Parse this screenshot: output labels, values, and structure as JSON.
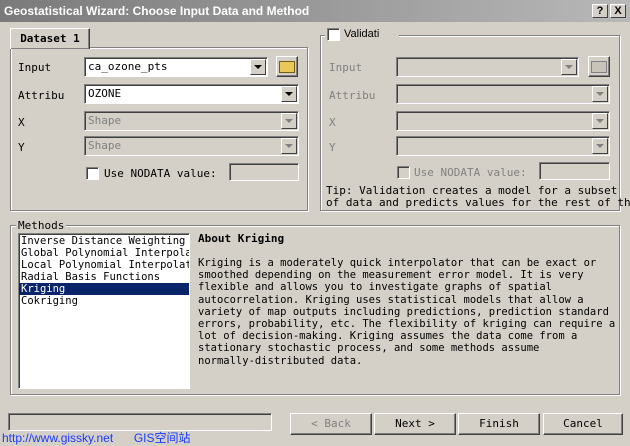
{
  "window": {
    "title": "Geostatistical Wizard: Choose Input Data and Method",
    "help_button": "?",
    "close_button": "X"
  },
  "dataset1": {
    "tab_label": "Dataset 1",
    "input_label": "Input",
    "input_value": "ca_ozone_pts",
    "attribute_label": "Attribu",
    "attribute_value": "OZONE",
    "x_label": "X",
    "x_value": "Shape",
    "y_label": "Y",
    "y_value": "Shape",
    "nodata_label": "Use NODATA value:",
    "nodata_value": ""
  },
  "validation": {
    "checkbox_label": "Validati",
    "input_label": "Input",
    "attribute_label": "Attribu",
    "x_label": "X",
    "y_label": "Y",
    "nodata_label": "Use NODATA value:",
    "tip_line1": "Tip:  Validation creates a model for a subset",
    "tip_line2": "of data and predicts values for the rest of the"
  },
  "methods": {
    "group_label": "Methods",
    "items": [
      "Inverse Distance Weighting",
      "Global Polynomial Interpolat",
      "Local Polynomial Interpolati",
      "Radial Basis Functions",
      "Kriging",
      "Cokriging"
    ],
    "selected": "Kriging",
    "about_title": "About Kriging",
    "about_lines": [
      "Kriging is a moderately quick interpolator that can be exact or",
      "smoothed depending on the measurement error model. It is very",
      "flexible and allows you to investigate graphs of spatial",
      "autocorrelation. Kriging uses statistical models that allow a",
      "variety of map outputs including predictions, prediction standard",
      "errors, probability, etc. The flexibility of kriging can require a",
      "lot of decision-making. Kriging assumes the data come from a",
      "stationary stochastic process, and some methods assume",
      "normally-distributed data."
    ]
  },
  "buttons": {
    "back": "< Back",
    "next": "Next >",
    "finish": "Finish",
    "cancel": "Cancel"
  },
  "watermark": {
    "url": "http://www.gissky.net",
    "site": "GIS空间站"
  },
  "colors": {
    "dialog_bg": "#d4d0c8",
    "selection": "#0a246a",
    "watermark": "#1a3aff"
  }
}
